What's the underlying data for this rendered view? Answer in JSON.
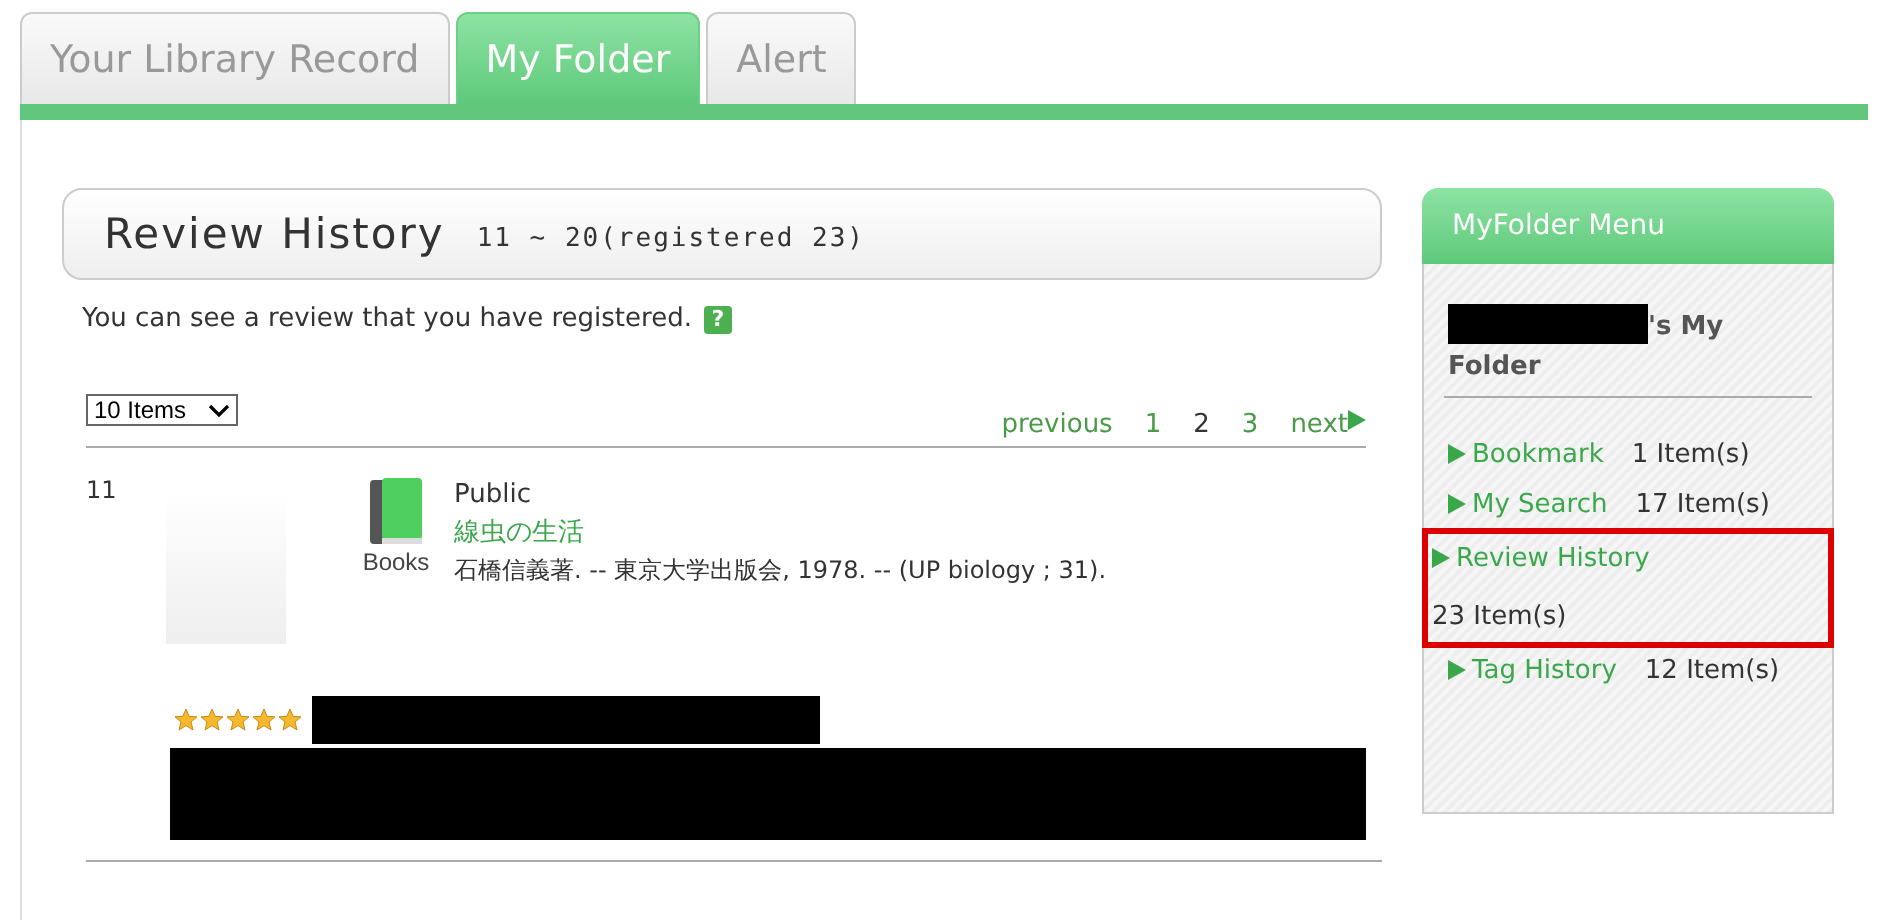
{
  "tabs": [
    {
      "label": "Your Library Record",
      "selected": false
    },
    {
      "label": "My Folder",
      "selected": true
    },
    {
      "label": "Alert",
      "selected": false
    }
  ],
  "heading": {
    "title": "Review History",
    "range": "11 ~ 20(registered 23)"
  },
  "intro": "You can see a review that you have registered.",
  "help_icon": "?",
  "page_size": {
    "value": "10 Items"
  },
  "pagination": {
    "previous": "previous",
    "pages": [
      {
        "label": "1",
        "selected": false
      },
      {
        "label": "2",
        "selected": true
      },
      {
        "label": "3",
        "selected": false
      }
    ],
    "next": "next"
  },
  "reviews": [
    {
      "number": "11",
      "material": "Books",
      "visibility": "Public",
      "title": "線虫の生活",
      "description": "石橋信義著. -- 東京大学出版会, 1978. -- (UP biology ; 31).",
      "stars": 5
    }
  ],
  "sidebar": {
    "title": "MyFolder Menu",
    "owner_label": [
      "'s My",
      "Folder"
    ],
    "items": [
      {
        "label": "Bookmark",
        "count": "1 Item(s)",
        "highlighted": false
      },
      {
        "label": "My Search",
        "count": "17 Item(s)",
        "highlighted": false
      },
      {
        "label": "Review History",
        "count": "23 Item(s)",
        "highlighted": true
      },
      {
        "label": "Tag History",
        "count": "12 Item(s)",
        "highlighted": false
      }
    ]
  }
}
